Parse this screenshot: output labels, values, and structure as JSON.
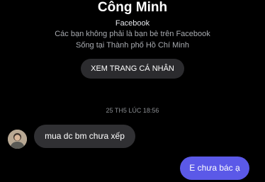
{
  "profile": {
    "name": "Công Minh",
    "source": "Facebook",
    "friend_status": "Các bạn không phải là bạn bè trên Facebook",
    "location": "Sống tại Thành phố Hồ Chí Minh",
    "view_profile_label": "XEM TRANG CÁ NHÂN"
  },
  "conversation": {
    "timestamp": "25 TH5 LÚC 18:56",
    "messages": [
      {
        "direction": "received",
        "text": "mua dc bm chưa xếp"
      },
      {
        "direction": "sent",
        "text": "E chưa bác ạ"
      }
    ]
  },
  "colors": {
    "background": "#000000",
    "received_bubble": "#303033",
    "sent_bubble": "#5b59e8",
    "button": "#2b2b2e"
  },
  "icons": {
    "avatar": "user-avatar"
  }
}
